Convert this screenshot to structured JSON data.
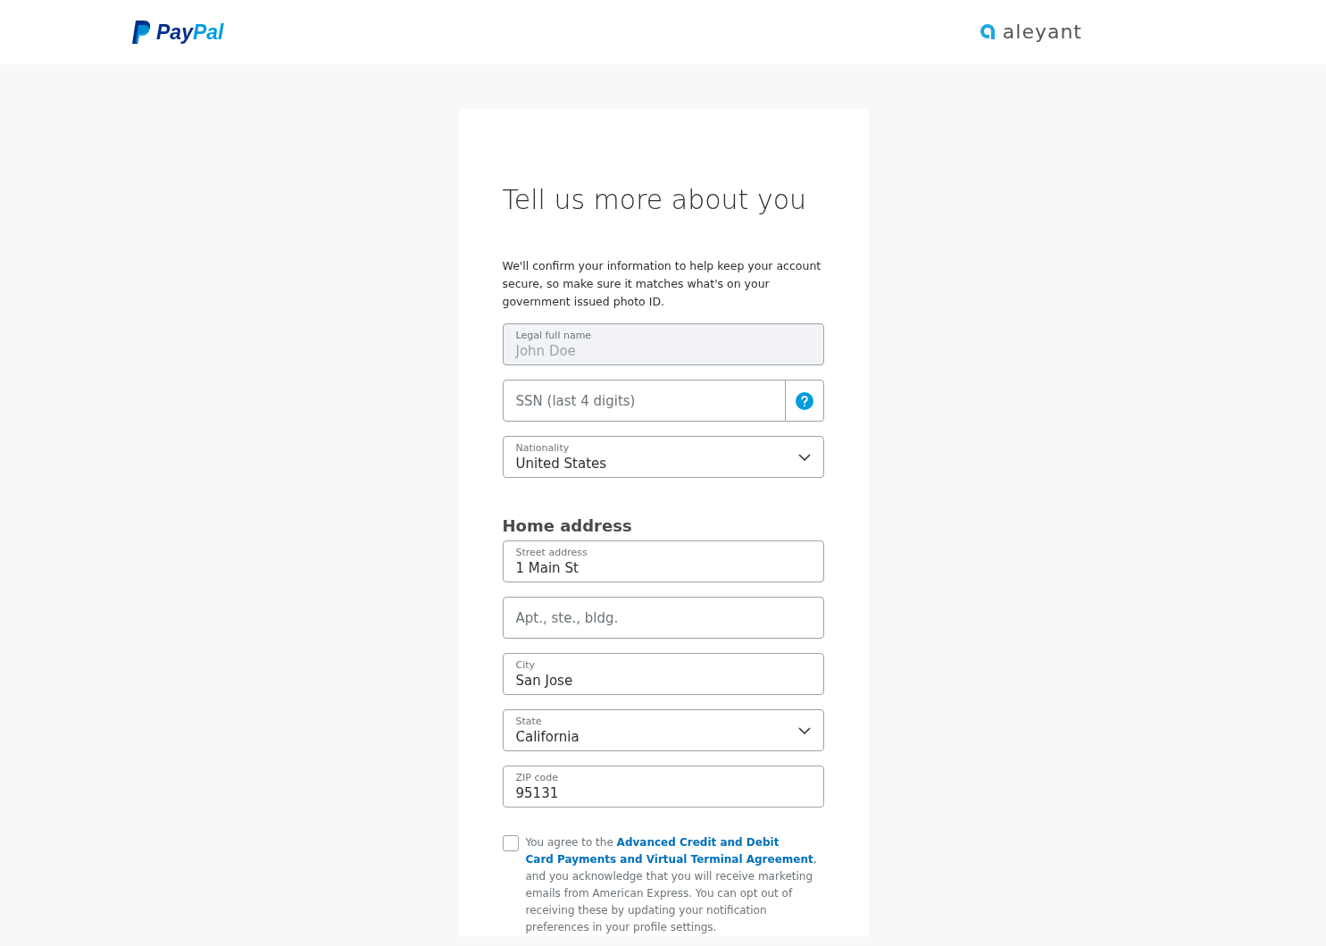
{
  "header": {
    "brand_parts": [
      "Pay",
      "Pal"
    ],
    "partner": "aleyant"
  },
  "form": {
    "title": "Tell us more about you",
    "intro": "We'll confirm your information to help keep your account secure, so make sure it matches what's on your government issued photo ID.",
    "fields": [
      {
        "kind": "text",
        "label": "Legal full name",
        "value": "John Doe",
        "disabled": true
      },
      {
        "kind": "help",
        "placeholder": "SSN (last 4 digits)"
      },
      {
        "kind": "select",
        "label": "Nationality",
        "value": "United States"
      }
    ],
    "address_heading": "Home address",
    "address_fields": [
      {
        "kind": "text",
        "label": "Street address",
        "value": "1 Main St",
        "disabled": false
      },
      {
        "kind": "text",
        "placeholder": "Apt., ste., bldg."
      },
      {
        "kind": "text",
        "label": "City",
        "value": "San Jose",
        "disabled": false
      },
      {
        "kind": "select",
        "label": "State",
        "value": "California"
      },
      {
        "kind": "text",
        "label": "ZIP code",
        "value": "95131",
        "disabled": false
      }
    ],
    "agreement": {
      "checked": false,
      "prefix": "You agree to the ",
      "link_lines": [
        "Advanced Credit and Debit",
        "Card Payments and Virtual Terminal Agreement"
      ],
      "suffix": ", and you acknowledge that you will receive marketing emails from American Express. You can opt out of receiving these by updating your notification preferences in your profile settings."
    }
  }
}
